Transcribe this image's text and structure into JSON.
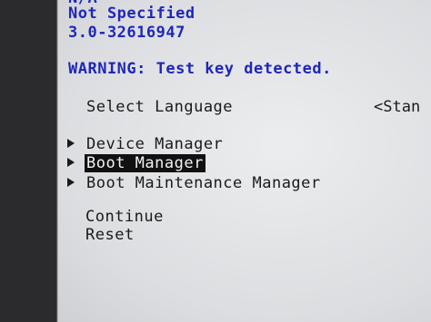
{
  "header": {
    "partial_line": "N/A",
    "not_specified": "Not Specified",
    "version": "3.0-32616947"
  },
  "warning": "WARNING: Test key detected.",
  "language": {
    "label": "Select Language",
    "value": "<Stan"
  },
  "menu": [
    {
      "label": "Device Manager",
      "selected": false
    },
    {
      "label": "Boot Manager",
      "selected": true
    },
    {
      "label": "Boot Maintenance Manager",
      "selected": false
    }
  ],
  "actions": {
    "continue": "Continue",
    "reset": "Reset"
  }
}
